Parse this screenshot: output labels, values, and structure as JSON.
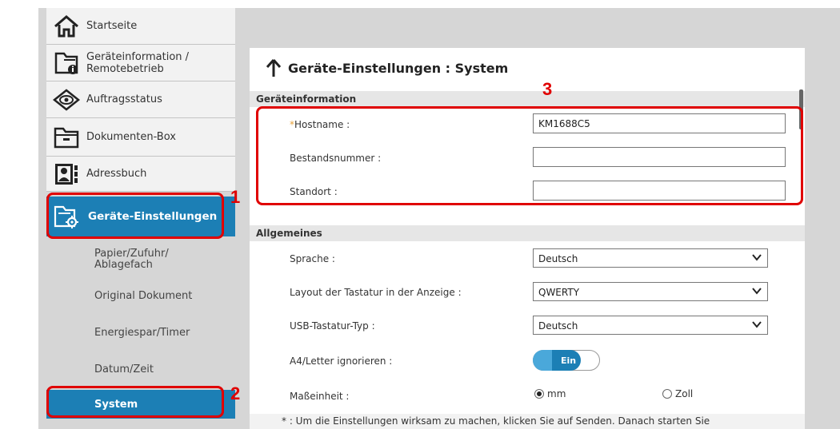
{
  "sidebar": {
    "items": [
      {
        "label": "Startseite",
        "icon": "home-icon"
      },
      {
        "label": "Geräteinformation / Remotebetrieb",
        "icon": "device-info-icon"
      },
      {
        "label": "Auftragsstatus",
        "icon": "eye-icon"
      },
      {
        "label": "Dokumenten-Box",
        "icon": "folder-icon"
      },
      {
        "label": "Adressbuch",
        "icon": "address-book-icon"
      },
      {
        "label": "Geräte-Einstellungen",
        "icon": "device-settings-icon"
      }
    ],
    "subitems": [
      {
        "label": "Papier/Zufuhr/ Ablagefach"
      },
      {
        "label": "Original Dokument"
      },
      {
        "label": "Energiespar/Timer"
      },
      {
        "label": "Datum/Zeit"
      },
      {
        "label": "System"
      }
    ]
  },
  "main": {
    "title": "Geräte-Einstellungen : System",
    "sections": {
      "geraeteinformation": "Geräteinformation",
      "allgemeines": "Allgemeines"
    },
    "fields": {
      "hostname": {
        "required_mark": "*",
        "label": "Hostname :",
        "value": "KM1688C5"
      },
      "bestandsnummer": {
        "label": "Bestandsnummer :",
        "value": ""
      },
      "standort": {
        "label": "Standort :",
        "value": ""
      },
      "sprache": {
        "label": "Sprache :",
        "value": "Deutsch"
      },
      "layout": {
        "label": "Layout der Tastatur in der Anzeige :",
        "value": "QWERTY"
      },
      "usb": {
        "label": "USB-Tastatur-Typ :",
        "value": "Deutsch"
      },
      "a4letter": {
        "label": "A4/Letter ignorieren :",
        "value": "Ein"
      },
      "masseinheit": {
        "label": "Maßeinheit :",
        "options": [
          "mm",
          "Zoll"
        ],
        "selected": "mm"
      }
    },
    "footnote": "* :  Um die Einstellungen wirksam zu machen, klicken Sie auf Senden. Danach starten Sie"
  },
  "annotations": {
    "callout1": "1",
    "callout2": "2",
    "callout3": "3"
  },
  "colors": {
    "accent": "#1c7fb5",
    "annotation": "#e00000",
    "required": "#e8a33b"
  }
}
